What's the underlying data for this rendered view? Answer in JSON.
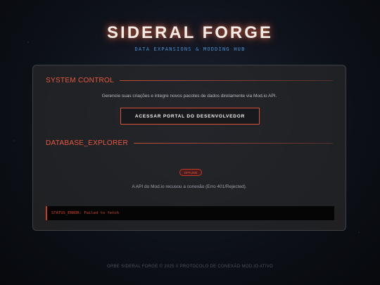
{
  "header": {
    "title": "SIDERAL FORGE",
    "subtitle": "DATA EXPANSIONS & MODDING HUB"
  },
  "system_control": {
    "title": "SYSTEM CONTROL",
    "description": "Gerencie suas criações e integre novos pacotes de dados diretamente via Mod.io API.",
    "portal_button_label": "ACESSAR PORTAL DO DESENVOLVEDOR"
  },
  "database_explorer": {
    "title": "DATABASE_EXPLORER",
    "status_badge": "OFFLINE",
    "error_message": "A API do Mod.io recusou a conexão (Erro 401/Rejected).",
    "console_text": "STATUS_ERROR: Failed to fetch"
  },
  "footer": {
    "text": "ORBE SIDERAL FORGE © 2025 // PROTOCOLO DE CONEXÃO MOD.IO ATIVO"
  },
  "colors": {
    "accent": "#e8583f",
    "subtitle_blue": "#4a8fd0",
    "background": "#0d1118",
    "panel": "#28282a"
  }
}
